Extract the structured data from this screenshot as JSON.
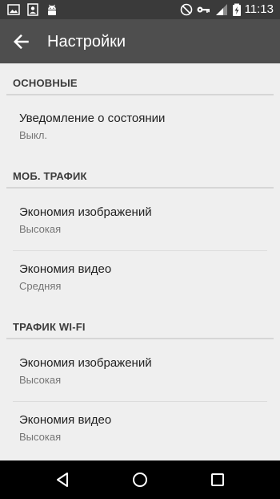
{
  "status_bar": {
    "time": "11:13",
    "left_icons": [
      "image-icon",
      "portrait-icon",
      "android-icon"
    ],
    "right_icons": [
      "do-not-disturb-icon",
      "vpn-key-icon",
      "signal-icon",
      "battery-charging-icon"
    ]
  },
  "app_bar": {
    "title": "Настройки",
    "back_icon": "arrow-back-icon"
  },
  "sections": [
    {
      "header": "ОСНОВНЫЕ",
      "items": [
        {
          "title": "Уведомление о состоянии",
          "summary": "Выкл."
        }
      ]
    },
    {
      "header": "МОБ. ТРАФИК",
      "items": [
        {
          "title": "Экономия изображений",
          "summary": "Высокая"
        },
        {
          "title": "Экономия видео",
          "summary": "Средняя"
        }
      ]
    },
    {
      "header": "ТРАФИК WI-FI",
      "items": [
        {
          "title": "Экономия изображений",
          "summary": "Высокая"
        },
        {
          "title": "Экономия видео",
          "summary": "Высокая"
        }
      ]
    }
  ],
  "nav_bar": {
    "icons": [
      "back-triangle-icon",
      "home-circle-icon",
      "recents-square-icon"
    ]
  },
  "colors": {
    "status_bar": "#3a3a3a",
    "app_bar": "#4e4e4e",
    "background": "#efefef",
    "divider": "#d6d6d6",
    "summary_text": "#757575",
    "nav_bar": "#000000"
  }
}
